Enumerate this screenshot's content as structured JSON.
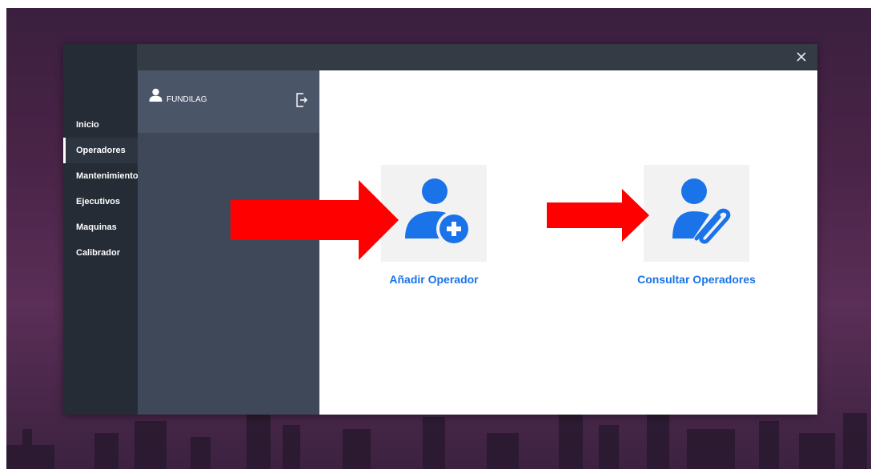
{
  "window": {
    "close_icon": "close-icon"
  },
  "nav": {
    "items": [
      {
        "label": "Inicio"
      },
      {
        "label": "Operadores"
      },
      {
        "label": "Mantenimiento"
      },
      {
        "label": "Ejecutivos"
      },
      {
        "label": "Maquinas"
      },
      {
        "label": "Calibrador"
      }
    ],
    "active": "Operadores"
  },
  "user": {
    "name": "FUNDILAG",
    "icon": "user-icon",
    "logout_icon": "logout-icon"
  },
  "actions": [
    {
      "label": "Añadir Operador",
      "icon": "add-user-icon"
    },
    {
      "label": "Consultar Operadores",
      "icon": "user-attachment-icon"
    }
  ],
  "colors": {
    "accent": "#1a73e8",
    "arrow": "#ff0000",
    "sidebar": "#252c36",
    "panel": "#3e4858"
  }
}
